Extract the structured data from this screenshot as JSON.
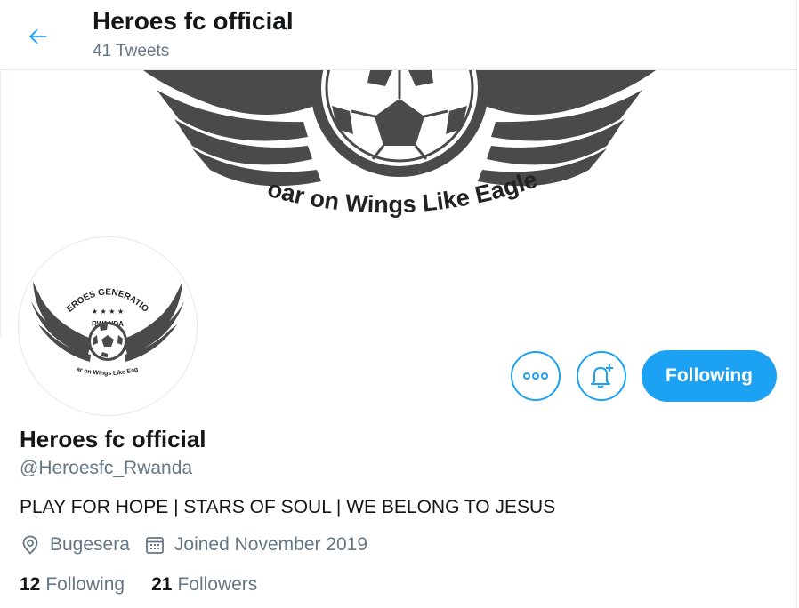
{
  "header": {
    "title": "Heroes fc official",
    "tweet_count": "41 Tweets",
    "back_icon": "arrow-left-icon"
  },
  "banner": {
    "motto": "Soar on Wings Like Eagles"
  },
  "avatar": {
    "arc_text": "HEROES GENERATION",
    "stars": "★ ★ ★ ★",
    "country": "RWANDA",
    "motto": "Soar on Wings Like Eagles"
  },
  "actions": {
    "more_icon": "more-horizontal-icon",
    "notify_icon": "bell-plus-icon",
    "following_label": "Following"
  },
  "profile": {
    "name": "Heroes fc official",
    "handle": "@Heroesfc_Rwanda",
    "bio": "PLAY FOR HOPE | STARS OF SOUL | WE BELONG TO JESUS",
    "location": "Bugesera",
    "joined": "Joined November 2019",
    "location_icon": "location-pin-icon",
    "calendar_icon": "calendar-icon"
  },
  "stats": {
    "following_count": "12",
    "following_label": "Following",
    "followers_count": "21",
    "followers_label": "Followers"
  },
  "colors": {
    "accent": "#1da1f2",
    "secondary_text": "#657786",
    "primary_text": "#14171a",
    "logo_gray": "#4a4a4a"
  }
}
